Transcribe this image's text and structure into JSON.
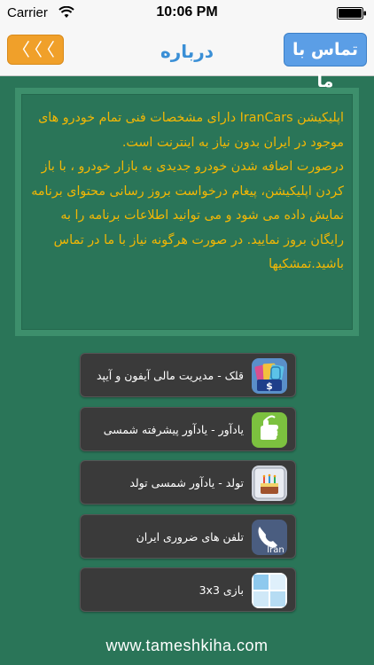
{
  "status_bar": {
    "carrier": "Carrier",
    "time": "10:06 PM"
  },
  "nav": {
    "back_label": "〈〈〈",
    "title": "درباره",
    "contact_label": "تماس با ما"
  },
  "about": {
    "text": "اپلیکیشن IranCars دارای مشخصات فنی تمام خودرو های موجود در ایران بدون نیاز به اینترنت است.\nدرصورت اضافه شدن خودرو جدیدی به بازار خودرو ، با باز کردن اپلیکیشن، پیغام درخواست بروز رسانی محتوای برنامه نمایش داده می شود و می توانید اطلاعات برنامه را به رایگان بروز نمایید. در صورت هرگونه نیاز با ما در تماس باشید.تمشکیها"
  },
  "apps": [
    {
      "label": "قلک - مدیریت مالی آیفون و آیپد",
      "icon": "piggy-bank-icon"
    },
    {
      "label": "یادآور - یادآور پیشرفته شمسی",
      "icon": "reminder-icon"
    },
    {
      "label": "تولد - یادآور شمسی تولد",
      "icon": "birthday-cake-icon"
    },
    {
      "label": "تلفن های ضروری ایران",
      "icon": "phone-iran-icon",
      "icon_text": "Iran"
    },
    {
      "label": "بازی 3x3",
      "icon": "grid-game-icon"
    }
  ],
  "footer": {
    "url": "www.tameshkiha.com"
  },
  "colors": {
    "background": "#2a7558",
    "accent_orange": "#f0a02a",
    "accent_blue": "#5b9ee6",
    "text_yellow": "#f2b705"
  }
}
